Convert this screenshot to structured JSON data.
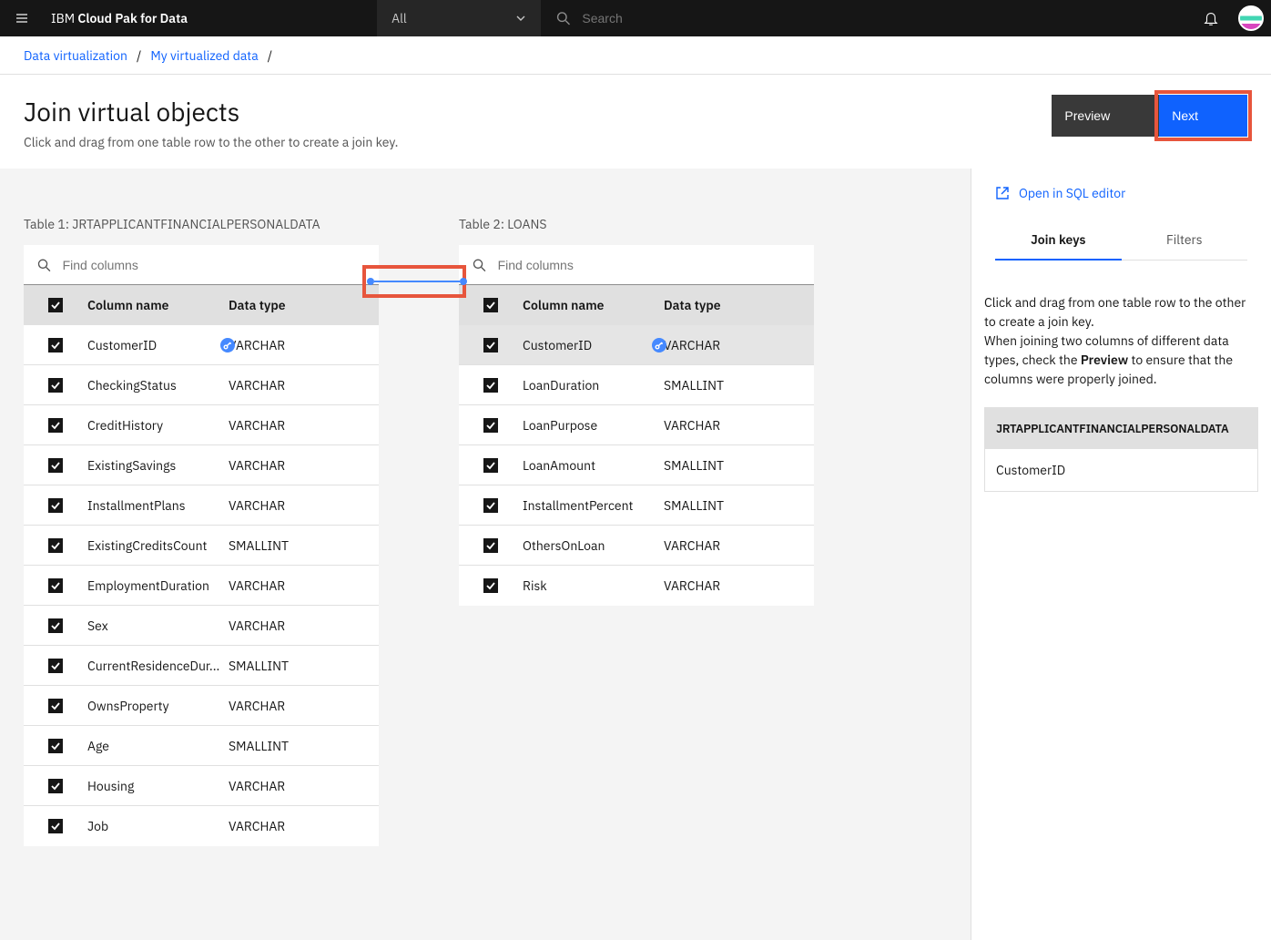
{
  "header": {
    "brand_prefix": "IBM ",
    "brand_bold": "Cloud Pak for Data",
    "dropdown_label": "All",
    "search_placeholder": "Search"
  },
  "breadcrumb": {
    "items": [
      "Data virtualization",
      "My virtualized data"
    ]
  },
  "page": {
    "title": "Join virtual objects",
    "subtitle": "Click and drag from one table row to the other to create a join key."
  },
  "buttons": {
    "preview": "Preview",
    "next": "Next"
  },
  "tables": {
    "find_placeholder": "Find columns",
    "col_name": "Column name",
    "col_type": "Data type",
    "t1": {
      "label": "Table 1: JRTAPPLICANTFINANCIALPERSONALDATA",
      "rows": [
        {
          "name": "CustomerID",
          "type": "VARCHAR",
          "key": true
        },
        {
          "name": "CheckingStatus",
          "type": "VARCHAR"
        },
        {
          "name": "CreditHistory",
          "type": "VARCHAR"
        },
        {
          "name": "ExistingSavings",
          "type": "VARCHAR"
        },
        {
          "name": "InstallmentPlans",
          "type": "VARCHAR"
        },
        {
          "name": "ExistingCreditsCount",
          "type": "SMALLINT"
        },
        {
          "name": "EmploymentDuration",
          "type": "VARCHAR"
        },
        {
          "name": "Sex",
          "type": "VARCHAR"
        },
        {
          "name": "CurrentResidenceDur...",
          "type": "SMALLINT"
        },
        {
          "name": "OwnsProperty",
          "type": "VARCHAR"
        },
        {
          "name": "Age",
          "type": "SMALLINT"
        },
        {
          "name": "Housing",
          "type": "VARCHAR"
        },
        {
          "name": "Job",
          "type": "VARCHAR"
        }
      ]
    },
    "t2": {
      "label": "Table 2: LOANS",
      "rows": [
        {
          "name": "CustomerID",
          "type": "VARCHAR",
          "key": true,
          "sel": true
        },
        {
          "name": "LoanDuration",
          "type": "SMALLINT"
        },
        {
          "name": "LoanPurpose",
          "type": "VARCHAR"
        },
        {
          "name": "LoanAmount",
          "type": "SMALLINT"
        },
        {
          "name": "InstallmentPercent",
          "type": "SMALLINT"
        },
        {
          "name": "OthersOnLoan",
          "type": "VARCHAR"
        },
        {
          "name": "Risk",
          "type": "VARCHAR"
        }
      ]
    }
  },
  "sidebar": {
    "open_sql": "Open in SQL editor",
    "tab_join": "Join keys",
    "tab_filters": "Filters",
    "help1": "Click and drag from one table row to the other to create a join key.",
    "help2a": "When joining two columns of different data types, check the ",
    "help2b": "Preview",
    "help2c": " to ensure that the columns were properly joined.",
    "key_table": "JRTAPPLICANTFINANCIALPERSONALDATA",
    "key_col": "CustomerID"
  }
}
